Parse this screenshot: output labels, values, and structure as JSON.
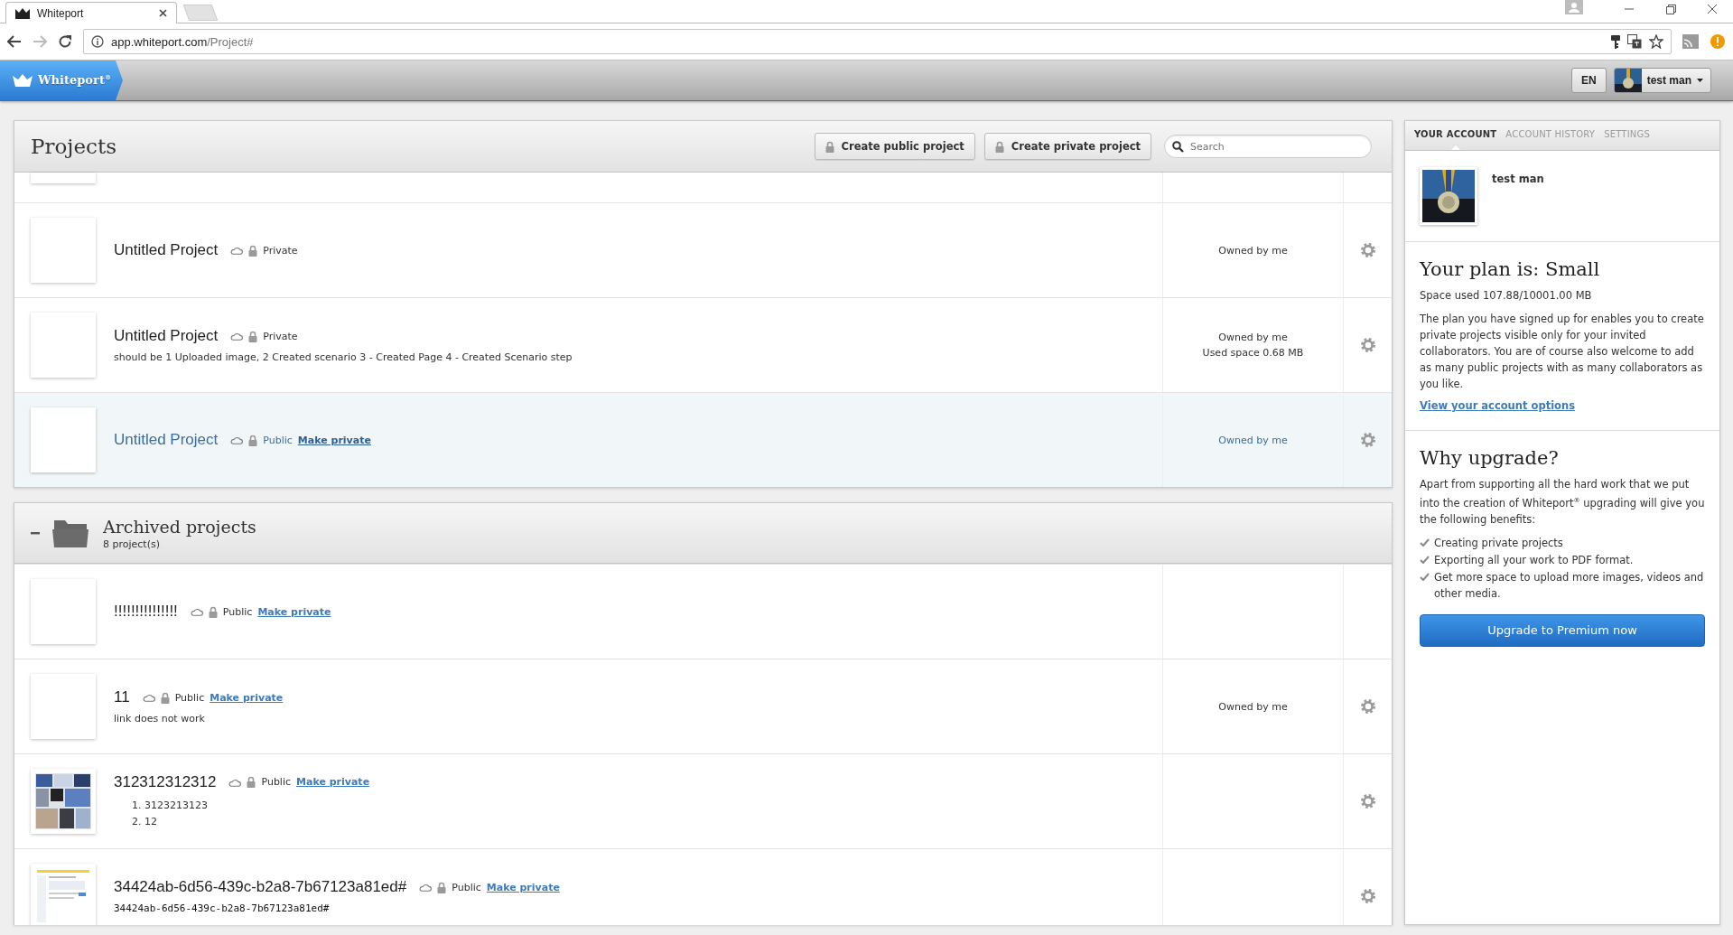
{
  "browser": {
    "tab_title": "Whiteport",
    "url_host": "app.whiteport.com",
    "url_path": "/Project#"
  },
  "header": {
    "logo": "Whiteport$^{®}$",
    "language": "EN",
    "user": "test man"
  },
  "projects": {
    "title": "Projects",
    "buttons": [
      "Create public project",
      "Create private project"
    ],
    "search": {
      "placeholder": "Search"
    },
    "rows": [
      {
        "kind": "cut",
        "thumbnail": {
          "kind": "blank"
        },
        "selected": false,
        "gear": false
      },
      {
        "kind": "project",
        "thumbnail": {
          "kind": "blank"
        },
        "name": "Untitled Project",
        "visibility": "Private",
        "owner": "Owned by me",
        "selected": false,
        "gear": true
      },
      {
        "kind": "project",
        "thumbnail": {
          "kind": "blank"
        },
        "name": "Untitled Project",
        "visibility": "Private",
        "description": "should be 1 Uploaded image,  2 Created scenario 3 - Created Page 4 - Created Scenario step",
        "owner": "Owned by me",
        "used_space": "Used space 0.68 MB",
        "selected": false,
        "gear": true
      },
      {
        "kind": "project",
        "thumbnail": {
          "kind": "blank"
        },
        "name": "Untitled Project",
        "visibility": "Public",
        "action": "Make private",
        "owner": "Owned by me",
        "selected": true,
        "gear": true
      }
    ]
  },
  "archived": {
    "title": "Archived projects",
    "count": "8 project(s)",
    "expanded": true,
    "rows": [
      {
        "kind": "project",
        "thumbnail": {
          "kind": "blank"
        },
        "name": "!!!!!!!!!!!!!!!",
        "visibility": "Public",
        "action": "Make private",
        "selected": false,
        "gear": false
      },
      {
        "kind": "project",
        "thumbnail": {
          "kind": "blank"
        },
        "name": "11",
        "visibility": "Public",
        "action": "Make private",
        "description": "link does not work",
        "owner": "Owned by me",
        "selected": false,
        "gear": true
      },
      {
        "kind": "project",
        "thumbnail": {
          "kind": "picture"
        },
        "name": "312312312312",
        "visibility": "Public",
        "action": "Make private",
        "list": [
          "1. 3123213123",
          "2. 12"
        ],
        "selected": false,
        "gear": true
      },
      {
        "kind": "project",
        "thumbnail": {
          "kind": "page"
        },
        "name": "34424ab-6d56-439c-b2a8-7b67123a81ed#",
        "visibility": "Public",
        "action": "Make private",
        "code": "34424ab-6d56-439c-b2a8-7b67123a81ed#",
        "selected": false,
        "gear": true
      }
    ]
  },
  "account": {
    "tabs": [
      {
        "label": "YOUR ACCOUNT",
        "selected": true
      },
      {
        "label": "ACCOUNT HISTORY",
        "selected": false
      },
      {
        "label": "SETTINGS",
        "selected": false
      }
    ],
    "name": "test man",
    "plan_title": "Your plan is: Small",
    "space_used": "Space used 107.88/10001.00 MB",
    "plan_text": "The plan you have signed up for enables you to create private projects visible only for your invited collaborators. You are of course also welcome to add as many public projects with as many collaborators as you like.",
    "options_link": "View your account options",
    "upgrade_title": "Why upgrade?",
    "upgrade_text": "Apart from supporting all the hard work that we put into the creation of Whiteport$^{®}$ upgrading will give you the following benefits:",
    "benefits": [
      "Creating private projects",
      "Exporting all your work to PDF format.",
      "Get more space to upload more images, videos and other media."
    ],
    "upgrade_button": "Upgrade to Premium now"
  }
}
